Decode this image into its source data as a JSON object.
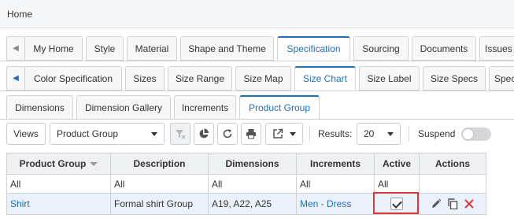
{
  "header": {
    "home": "Home"
  },
  "tabs_row1": [
    "My Home",
    "Style",
    "Material",
    "Shape and Theme",
    "Specification",
    "Sourcing",
    "Documents",
    "Issues"
  ],
  "tabs_row2": [
    "Color Specification",
    "Sizes",
    "Size Range",
    "Size Map",
    "Size Chart",
    "Size Label",
    "Size Specs",
    "Spec"
  ],
  "tabs_row3": [
    "Dimensions",
    "Dimension Gallery",
    "Increments",
    "Product Group"
  ],
  "toolbar": {
    "views_label": "Views",
    "view_select": "Product Group",
    "results_label": "Results:",
    "results_value": "20",
    "suspend_label": "Suspend"
  },
  "table": {
    "columns": [
      "Product Group",
      "Description",
      "Dimensions",
      "Increments",
      "Active",
      "Actions"
    ],
    "filters": [
      "All",
      "All",
      "All",
      "All",
      "All"
    ],
    "rows": [
      {
        "product_group": "Shirt",
        "description": "Formal shirt Group",
        "dimensions": "A19, A22, A25",
        "increments": "Men - Dress",
        "active": true
      }
    ]
  },
  "colors": {
    "accent": "#1f6fbf",
    "highlight_border": "#d9383a",
    "selected_row": "#eaf1fb"
  }
}
